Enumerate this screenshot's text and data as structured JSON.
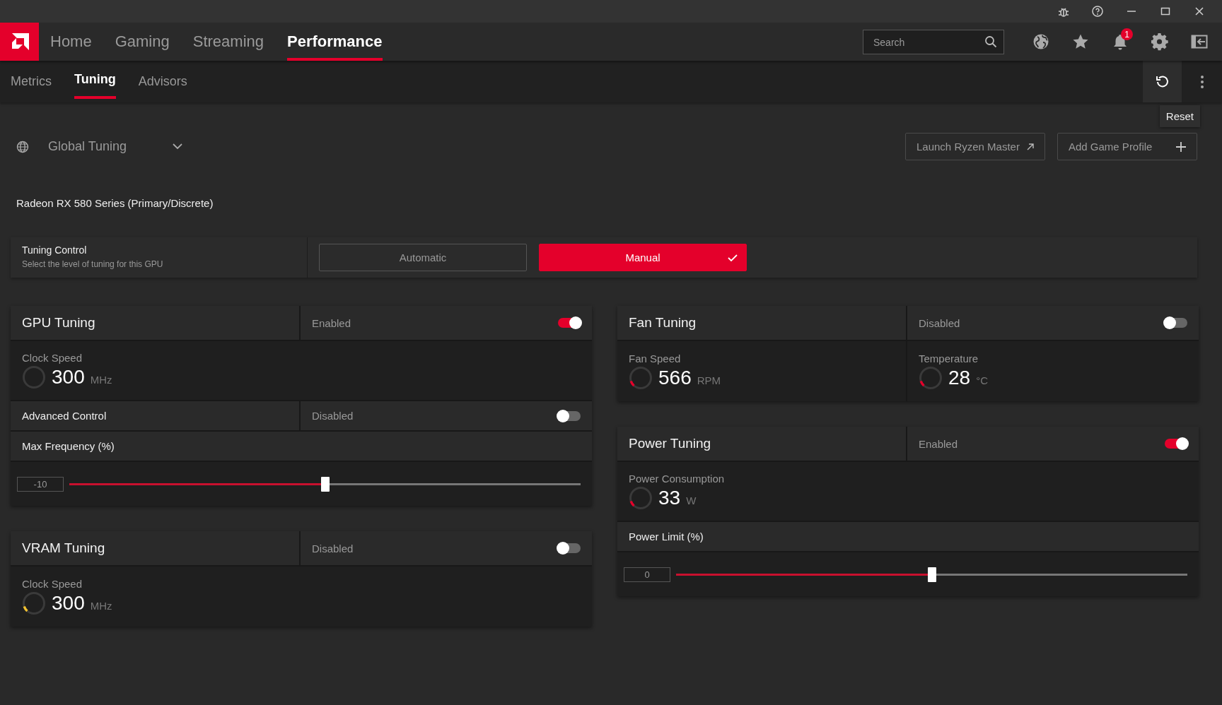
{
  "nav": {
    "tabs": [
      {
        "label": "Home",
        "selected": false
      },
      {
        "label": "Gaming",
        "selected": false
      },
      {
        "label": "Streaming",
        "selected": false
      },
      {
        "label": "Performance",
        "selected": true
      }
    ]
  },
  "search": {
    "placeholder": "Search"
  },
  "notifications": {
    "badge": "1"
  },
  "subtabs": [
    {
      "label": "Metrics",
      "selected": false
    },
    {
      "label": "Tuning",
      "selected": true
    },
    {
      "label": "Advisors",
      "selected": false
    }
  ],
  "tooltip": "Reset",
  "profile": {
    "label": "Global Tuning"
  },
  "actions": [
    {
      "label": "Launch Ryzen Master",
      "kind": "external"
    },
    {
      "label": "Add Game Profile",
      "kind": "add"
    }
  ],
  "device": "Radeon RX 580 Series (Primary/Discrete)",
  "tuning_control": {
    "title": "Tuning Control",
    "subtitle": "Select the level of tuning for this GPU",
    "options": [
      {
        "label": "Automatic",
        "selected": false
      },
      {
        "label": "Manual",
        "selected": true
      }
    ]
  },
  "columns": [
    [
      {
        "title": "GPU Tuning",
        "status": "Enabled",
        "on": true,
        "rows": [
          {
            "kind": "metrics",
            "metrics": [
              {
                "label": "Clock Speed",
                "value": "300",
                "unit": "MHz"
              }
            ]
          },
          {
            "kind": "toggle",
            "label": "Advanced Control",
            "status": "Disabled",
            "on": false
          },
          {
            "kind": "heading",
            "label": "Max Frequency (%)"
          },
          {
            "kind": "slider",
            "value": "-10",
            "level": 0.5
          }
        ]
      },
      {
        "title": "VRAM Tuning",
        "status": "Disabled",
        "on": false,
        "rows": [
          {
            "kind": "metrics",
            "metrics": [
              {
                "label": "Clock Speed",
                "value": "300",
                "unit": "MHz",
                "color": "#f2c230"
              }
            ]
          }
        ]
      }
    ],
    [
      {
        "title": "Fan Tuning",
        "status": "Disabled",
        "on": false,
        "rows": [
          {
            "kind": "metrics",
            "metrics": [
              {
                "label": "Fan Speed",
                "value": "566",
                "unit": "RPM",
                "color": "#e4002b"
              },
              {
                "label": "Temperature",
                "value": "28",
                "unit": "°C",
                "color": "#e4002b"
              }
            ]
          }
        ]
      },
      {
        "title": "Power Tuning",
        "status": "Enabled",
        "on": true,
        "rows": [
          {
            "kind": "metrics",
            "metrics": [
              {
                "label": "Power Consumption",
                "value": "33",
                "unit": "W",
                "color": "#e4002b"
              }
            ]
          },
          {
            "kind": "heading",
            "label": "Power Limit (%)"
          },
          {
            "kind": "slider",
            "value": "0",
            "level": 0.5
          }
        ]
      }
    ]
  ]
}
